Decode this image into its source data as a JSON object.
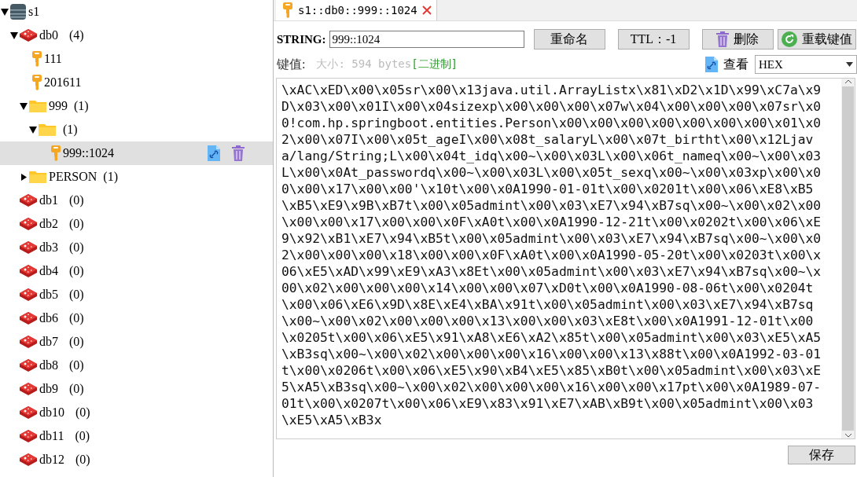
{
  "tree": {
    "kind": "server",
    "label": "s1",
    "expanded": true,
    "children": [
      {
        "kind": "db",
        "label": "db0",
        "count": "(4)",
        "expanded": true,
        "children": [
          {
            "kind": "key",
            "label": "111",
            "selected": false
          },
          {
            "kind": "key",
            "label": "201611",
            "selected": false
          },
          {
            "kind": "folder",
            "label": "999",
            "count": "(1)",
            "expanded": true,
            "children": [
              {
                "kind": "folder",
                "count": "(1)",
                "expanded": true,
                "children": [
                  {
                    "kind": "key",
                    "label": "999::1024",
                    "selected": true
                  }
                ]
              }
            ]
          },
          {
            "kind": "folder",
            "label": "PERSON",
            "count": "(1)",
            "expanded": false
          }
        ]
      },
      {
        "kind": "db",
        "label": "db1",
        "count": "(0)"
      },
      {
        "kind": "db",
        "label": "db2",
        "count": "(0)"
      },
      {
        "kind": "db",
        "label": "db3",
        "count": "(0)"
      },
      {
        "kind": "db",
        "label": "db4",
        "count": "(0)"
      },
      {
        "kind": "db",
        "label": "db5",
        "count": "(0)"
      },
      {
        "kind": "db",
        "label": "db6",
        "count": "(0)"
      },
      {
        "kind": "db",
        "label": "db7",
        "count": "(0)"
      },
      {
        "kind": "db",
        "label": "db8",
        "count": "(0)"
      },
      {
        "kind": "db",
        "label": "db9",
        "count": "(0)"
      },
      {
        "kind": "db",
        "label": "db10",
        "count": "(0)"
      },
      {
        "kind": "db",
        "label": "db11",
        "count": "(0)"
      },
      {
        "kind": "db",
        "label": "db12",
        "count": "(0)"
      }
    ]
  },
  "tab": {
    "label": "s1::db0::999::1024"
  },
  "toolbar": {
    "type_label": "STRING:",
    "key_value": "999::1024",
    "buttons": [
      {
        "kind": "plain",
        "label": "重命名"
      },
      {
        "kind": "plain",
        "label": "TTL：-1"
      },
      {
        "kind": "delete",
        "label": "删除"
      },
      {
        "kind": "reload",
        "label": "重载键值"
      }
    ]
  },
  "value_bar": {
    "label": "键值:",
    "size": "大小: 594 bytes",
    "format": "[二进制]",
    "view_label": "查看",
    "view_mode": "HEX"
  },
  "value_text": "\\xAC\\xED\\x00\\x05sr\\x00\\x13java.util.ArrayListx\\x81\\xD2\\x1D\\x99\\xC7a\\x9D\\x03\\x00\\x01I\\x00\\x04sizexp\\x00\\x00\\x00\\x07w\\x04\\x00\\x00\\x00\\x07sr\\x00!com.hp.springboot.entities.Person\\x00\\x00\\x00\\x00\\x00\\x00\\x00\\x01\\x02\\x00\\x07I\\x00\\x05t_ageI\\x00\\x08t_salaryL\\x00\\x07t_birtht\\x00\\x12Ljava/lang/String;L\\x00\\x04t_idq\\x00~\\x00\\x03L\\x00\\x06t_nameq\\x00~\\x00\\x03L\\x00\\x0At_passwordq\\x00~\\x00\\x03L\\x00\\x05t_sexq\\x00~\\x00\\x03xp\\x00\\x00\\x00\\x17\\x00\\x00'\\x10t\\x00\\x0A1990-01-01t\\x00\\x0201t\\x00\\x06\\xE8\\xB5\\xB5\\xE9\\x9B\\xB7t\\x00\\x05admint\\x00\\x03\\xE7\\x94\\xB7sq\\x00~\\x00\\x02\\x00\\x00\\x00\\x17\\x00\\x00\\x0F\\xA0t\\x00\\x0A1990-12-21t\\x00\\x0202t\\x00\\x06\\xE9\\x92\\xB1\\xE7\\x94\\xB5t\\x00\\x05admint\\x00\\x03\\xE7\\x94\\xB7sq\\x00~\\x00\\x02\\x00\\x00\\x00\\x18\\x00\\x00\\x0F\\xA0t\\x00\\x0A1990-05-20t\\x00\\x0203t\\x00\\x06\\xE5\\xAD\\x99\\xE9\\xA3\\x8Et\\x00\\x05admint\\x00\\x03\\xE7\\x94\\xB7sq\\x00~\\x00\\x02\\x00\\x00\\x00\\x14\\x00\\x00\\x07\\xD0t\\x00\\x0A1990-08-06t\\x00\\x0204t\\x00\\x06\\xE6\\x9D\\x8E\\xE4\\xBA\\x91t\\x00\\x05admint\\x00\\x03\\xE7\\x94\\xB7sq\\x00~\\x00\\x02\\x00\\x00\\x00\\x13\\x00\\x00\\x03\\xE8t\\x00\\x0A1991-12-01t\\x00\\x0205t\\x00\\x06\\xE5\\x91\\xA8\\xE6\\xA2\\x85t\\x00\\x05admint\\x00\\x03\\xE5\\xA5\\xB3sq\\x00~\\x00\\x02\\x00\\x00\\x00\\x16\\x00\\x00\\x13\\x88t\\x00\\x0A1992-03-01t\\x00\\x0206t\\x00\\x06\\xE5\\x90\\xB4\\xE5\\x85\\xB0t\\x00\\x05admint\\x00\\x03\\xE5\\xA5\\xB3sq\\x00~\\x00\\x02\\x00\\x00\\x00\\x16\\x00\\x00\\x17pt\\x00\\x0A1989-07-01t\\x00\\x0207t\\x00\\x06\\xE9\\x83\\x91\\xE7\\xAB\\xB9t\\x00\\x05admint\\x00\\x03\\xE5\\xA5\\xB3x",
  "save_button": "保存"
}
